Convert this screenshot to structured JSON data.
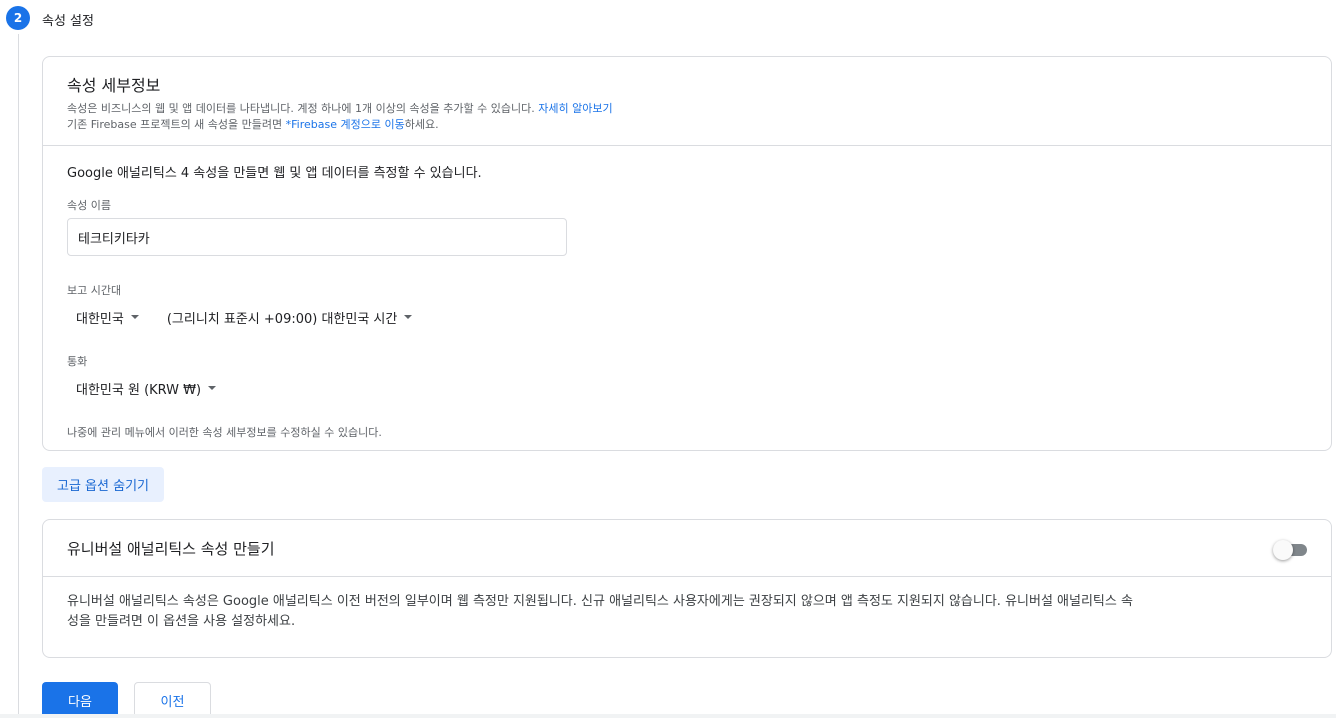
{
  "step": {
    "number": "2",
    "title": "속성 설정"
  },
  "details": {
    "title": "속성 세부정보",
    "desc_line1": "속성은 비즈니스의 웹 및 앱 데이터를 나타냅니다. 계정 하나에 1개 이상의 속성을 추가할 수 있습니다.",
    "desc_line1_link": "자세히 알아보기",
    "desc_line2_prefix": "기존 Firebase 프로젝트의 새 속성을 만들려면",
    "desc_line2_link": "*Firebase 계정으로 이동",
    "desc_line2_suffix": "하세요.",
    "intro": "Google 애널리틱스 4 속성을 만들면 웹 및 앱 데이터를 측정할 수 있습니다.",
    "name_label": "속성 이름",
    "name_value": "테크티키타카",
    "timezone_label": "보고 시간대",
    "country_value": "대한민국",
    "timezone_value": "(그리니치 표준시 +09:00) 대한민국 시간",
    "currency_label": "통화",
    "currency_value": "대한민국 원 (KRW ₩)",
    "footnote": "나중에 관리 메뉴에서 이러한 속성 세부정보를 수정하실 수 있습니다."
  },
  "advanced_button": "고급 옵션 숨기기",
  "universal": {
    "title": "유니버설 애널리틱스 속성 만들기",
    "toggle_state": "off",
    "body_line1": "유니버설 애널리틱스 속성은 Google 애널리틱스 이전 버전의 일부이며 웹 측정만 지원됩니다. 신규 애널리틱스 사용자에게는 권장되지 않으며 앱 측정도 지원되지 않습니다. 유니버설 애널리틱스 속",
    "body_line2": "성을 만들려면 이 옵션을 사용 설정하세요."
  },
  "buttons": {
    "next": "다음",
    "prev": "이전"
  },
  "colors": {
    "accent": "#1a73e8",
    "border": "#dadce0",
    "advanced_bg": "#e8f0fe"
  }
}
